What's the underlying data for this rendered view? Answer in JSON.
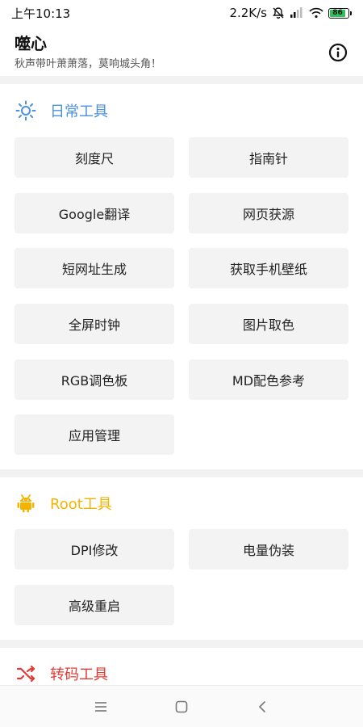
{
  "status": {
    "time": "上午10:13",
    "speed": "2.2K/s",
    "battery": "86",
    "colors": {
      "battery_fill": "#2fc15d"
    }
  },
  "header": {
    "title": "噬心",
    "subtitle": "秋声带叶萧萧落，莫响城头角！",
    "info_icon": "info-icon"
  },
  "sections": [
    {
      "title": "日常工具",
      "icon": "sun-icon",
      "color": "#4a90e2",
      "items": [
        "刻度尺",
        "指南针",
        "Google翻译",
        "网页获源",
        "短网址生成",
        "获取手机壁纸",
        "全屏时钟",
        "图片取色",
        "RGB调色板",
        "MD配色参考",
        "应用管理"
      ]
    },
    {
      "title": "Root工具",
      "icon": "android-icon",
      "color": "#f5b301",
      "items": [
        "DPI修改",
        "电量伪装",
        "高级重启"
      ]
    },
    {
      "title": "转码工具",
      "icon": "shuffle-icon",
      "color": "#e53935",
      "items": []
    }
  ],
  "nav": {
    "menu_icon": "menu-icon",
    "home_icon": "home-icon",
    "back_icon": "back-icon"
  }
}
